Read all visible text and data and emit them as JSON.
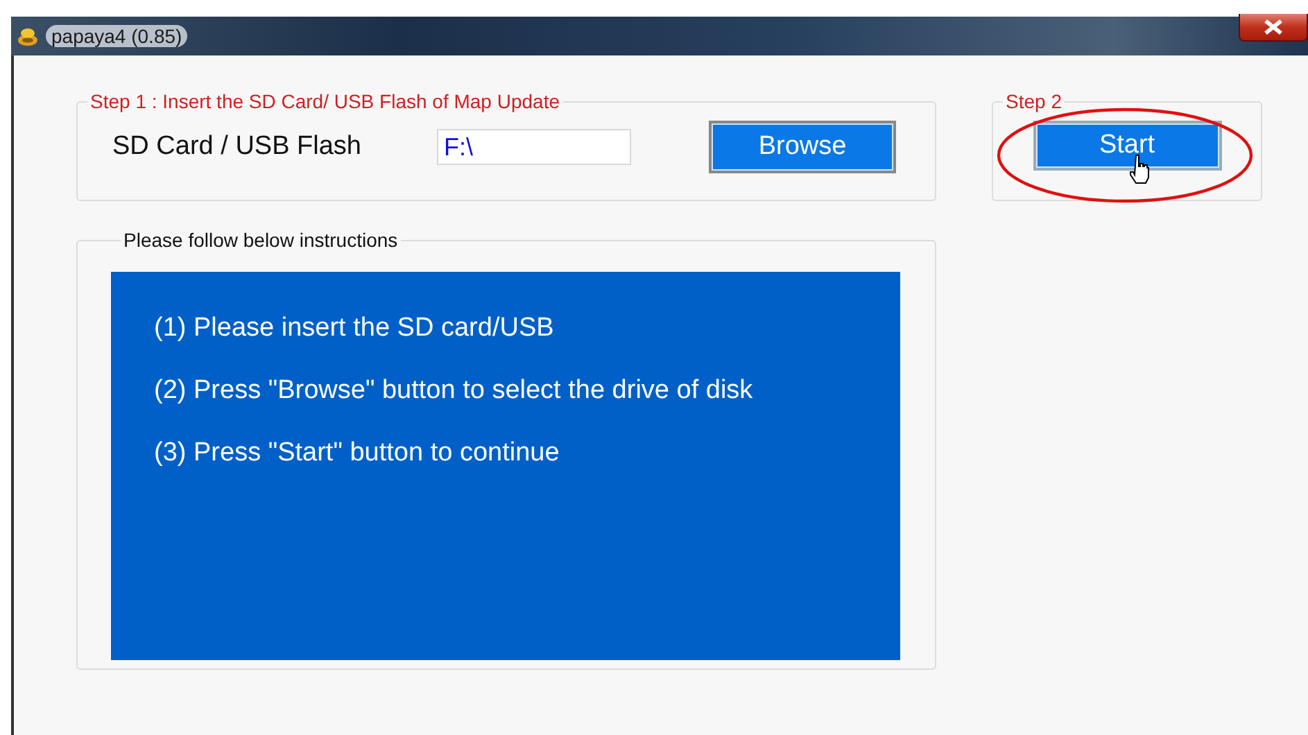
{
  "window": {
    "title": "papaya4 (0.85)"
  },
  "step1": {
    "legend": "Step 1 : Insert the SD Card/ USB Flash of Map Update",
    "label": "SD Card / USB Flash",
    "value": "F:\\",
    "button": "Browse"
  },
  "step2": {
    "legend": "Step 2",
    "button": "Start",
    "highlighted": true
  },
  "instructions": {
    "legend": "Please follow below instructions",
    "lines": [
      "(1) Please insert the SD card/USB",
      "(2) Press \"Browse\" button to select the drive of disk",
      "(3) Press \"Start\" button to continue"
    ]
  }
}
